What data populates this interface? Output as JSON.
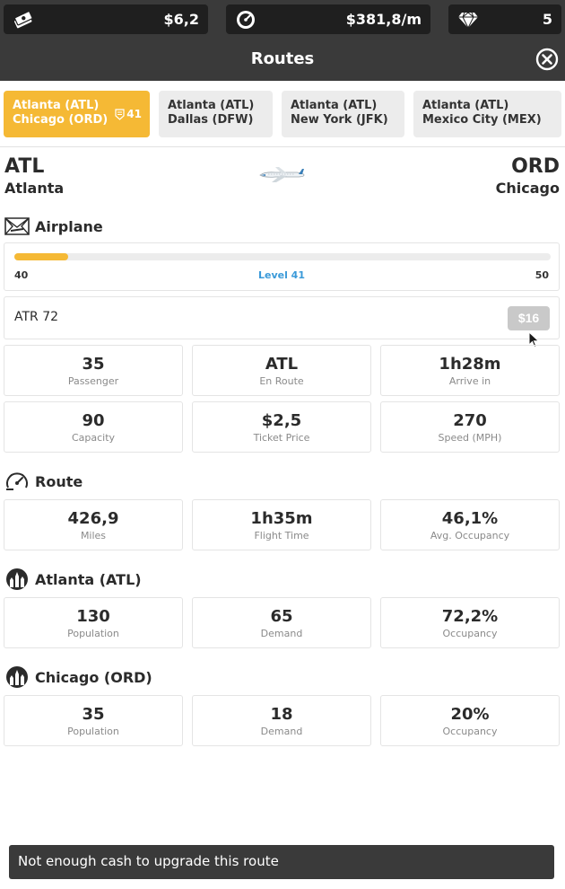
{
  "resources": {
    "cash": "$6,2",
    "income": "$381,8/m",
    "gems": "5"
  },
  "header": {
    "title": "Routes"
  },
  "tabs": [
    {
      "line1": "Atlanta (ATL)",
      "line2": "Chicago (ORD)",
      "level": "41",
      "active": true
    },
    {
      "line1": "Atlanta (ATL)",
      "line2": "Dallas (DFW)",
      "active": false
    },
    {
      "line1": "Atlanta (ATL)",
      "line2": "New York (JFK)",
      "active": false
    },
    {
      "line1": "Atlanta (ATL)",
      "line2": "Mexico City (MEX)",
      "active": false
    }
  ],
  "route": {
    "from_code": "ATL",
    "from_city": "Atlanta",
    "to_code": "ORD",
    "to_city": "Chicago"
  },
  "airplane": {
    "section_title": "Airplane",
    "level_min": "40",
    "level_max": "50",
    "level_label": "Level 41",
    "level_progress": 0.1,
    "model": "ATR 72",
    "upgrade_price": "$16",
    "stats": [
      {
        "value": "35",
        "label": "Passenger"
      },
      {
        "value": "ATL",
        "label": "En Route"
      },
      {
        "value": "1h28m",
        "label": "Arrive in"
      },
      {
        "value": "90",
        "label": "Capacity"
      },
      {
        "value": "$2,5",
        "label": "Ticket Price"
      },
      {
        "value": "270",
        "label": "Speed (MPH)"
      }
    ]
  },
  "route_stats": {
    "section_title": "Route",
    "stats": [
      {
        "value": "426,9",
        "label": "Miles"
      },
      {
        "value": "1h35m",
        "label": "Flight Time"
      },
      {
        "value": "46,1%",
        "label": "Avg. Occupancy"
      }
    ]
  },
  "origin": {
    "section_title": "Atlanta (ATL)",
    "stats": [
      {
        "value": "130",
        "label": "Population"
      },
      {
        "value": "65",
        "label": "Demand"
      },
      {
        "value": "72,2%",
        "label": "Occupancy"
      }
    ]
  },
  "destination": {
    "section_title": "Chicago (ORD)",
    "stats": [
      {
        "value": "35",
        "label": "Population"
      },
      {
        "value": "18",
        "label": "Demand"
      },
      {
        "value": "20%",
        "label": "Occupancy"
      }
    ]
  },
  "toast": {
    "message": "Not enough cash to upgrade this route"
  },
  "colors": {
    "accent": "#f5b935",
    "level_text": "#3a9ad9",
    "bar_dark": "#3a3a3a"
  }
}
